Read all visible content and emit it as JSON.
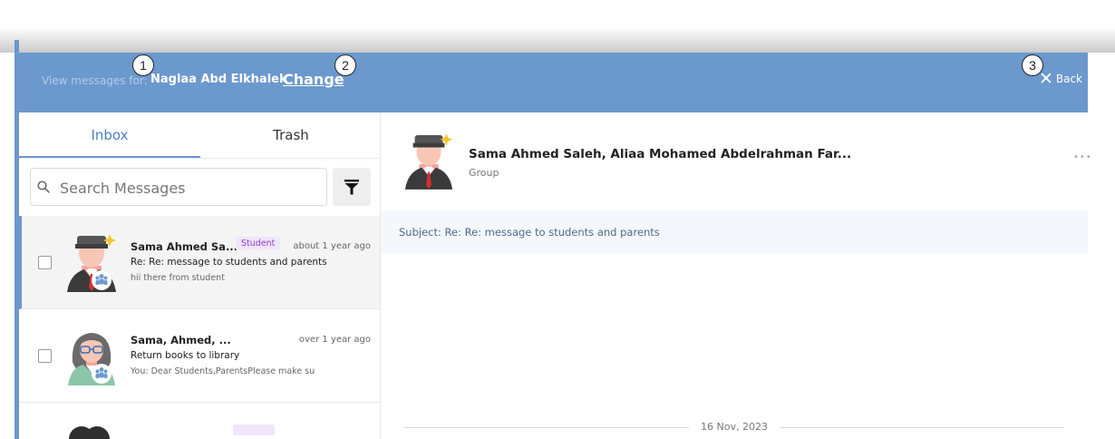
{
  "header": {
    "view_messages_label": "View messages for:",
    "user_name": "Naglaa Abd Elkhalek",
    "change_label": "Change",
    "back_label": "Back"
  },
  "callouts": [
    "1",
    "2",
    "3"
  ],
  "tabs": [
    {
      "label": "Inbox",
      "active": true
    },
    {
      "label": "Trash",
      "active": false
    }
  ],
  "search": {
    "placeholder": "Search Messages"
  },
  "messages": [
    {
      "name": "Sama Ahmed Sa...",
      "role": "Student",
      "time": "about 1 year ago",
      "subject": "Re: Re: message to students and parents",
      "preview": "hii there from student",
      "avatar": "male-student-avatar",
      "selected": true
    },
    {
      "name": "Sama, Ahmed, ...",
      "role": "",
      "time": "over 1 year ago",
      "subject": "Return books to library",
      "preview": "You: Dear Students,ParentsPlease make su",
      "avatar": "female-teacher-avatar",
      "selected": false
    }
  ],
  "conversation": {
    "title": "Sama Ahmed Saleh, Aliaa Mohamed Abdelrahman Far...",
    "subtitle": "Group",
    "subject": "Subject: Re: Re: message to students and parents",
    "date": "16 Nov, 2023",
    "more_label": "•••"
  },
  "colors": {
    "header_bg": "#6b98cd",
    "accent": "#4b7fc2",
    "student_badge": "#8a3ec6",
    "subject_bar_bg": "#f4f8fc"
  }
}
